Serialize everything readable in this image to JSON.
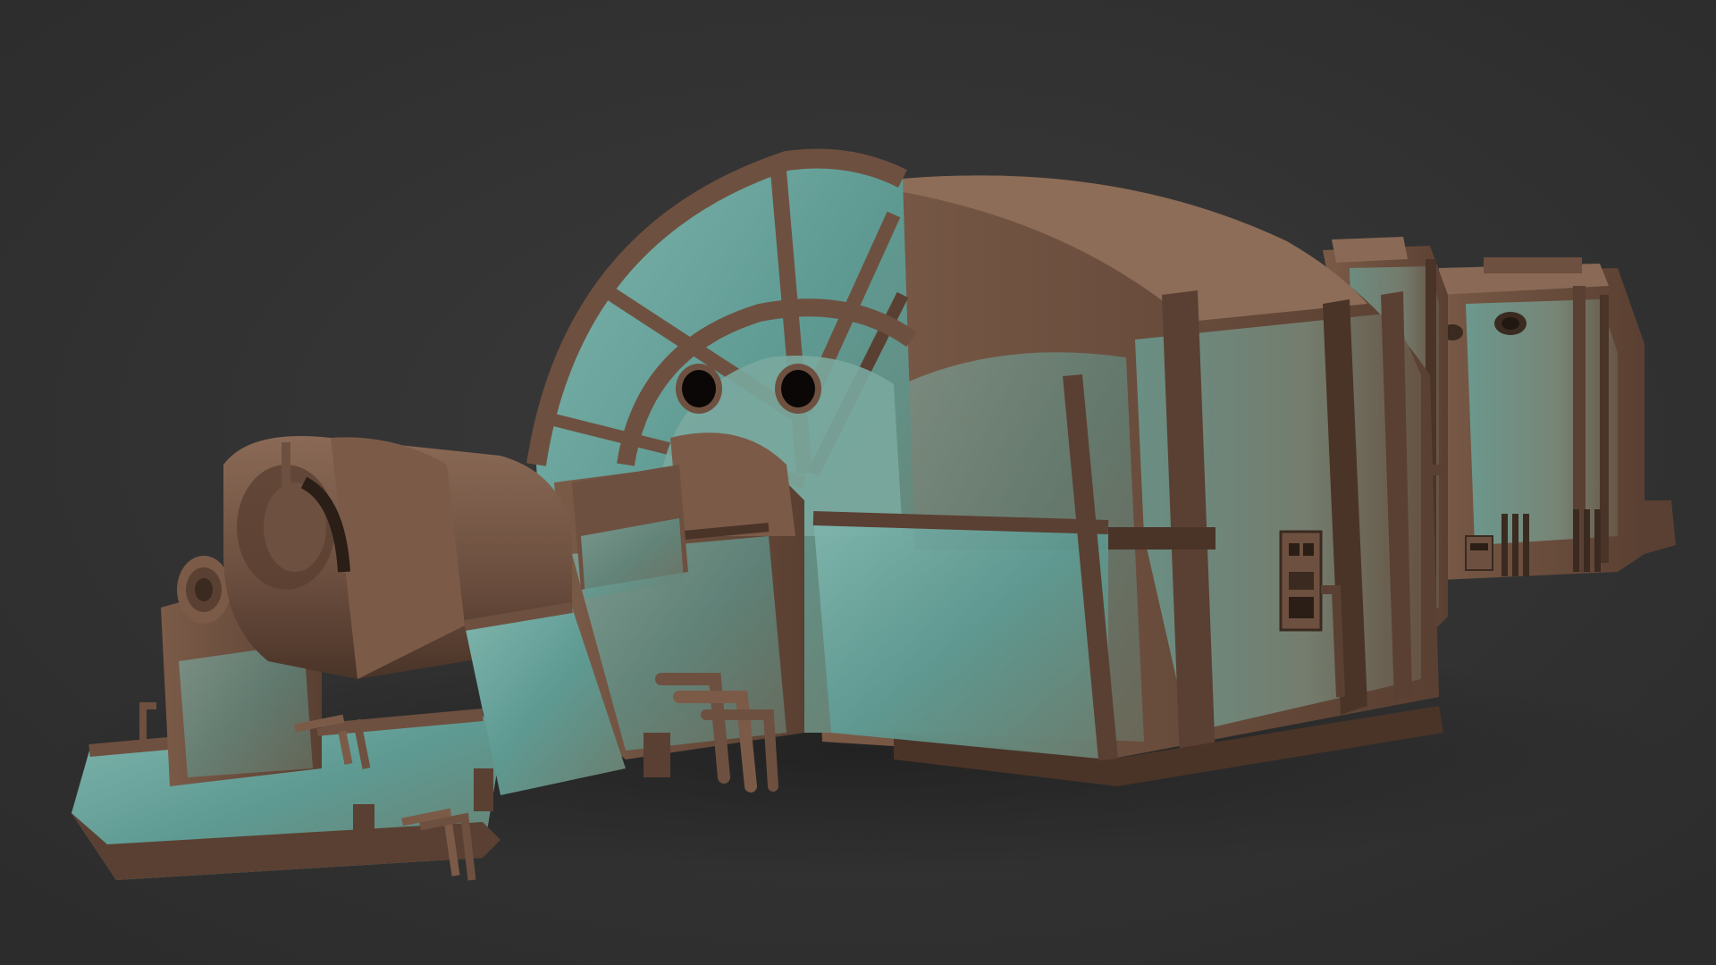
{
  "scene": {
    "subject": "rusty-industrial-turbine-generator-3d-render",
    "colors": {
      "background": "#2f2f2f",
      "background_center": "#3a3a3a",
      "rust_dark": "#4a3428",
      "rust": "#7a5a47",
      "rust_light": "#9a7b66",
      "teal": "#5e9a92",
      "teal_light": "#7fb5ad",
      "shadow": "#232323"
    },
    "icons": [
      "gauge-panel-icon",
      "porthole-icon",
      "pipe-icon"
    ]
  }
}
